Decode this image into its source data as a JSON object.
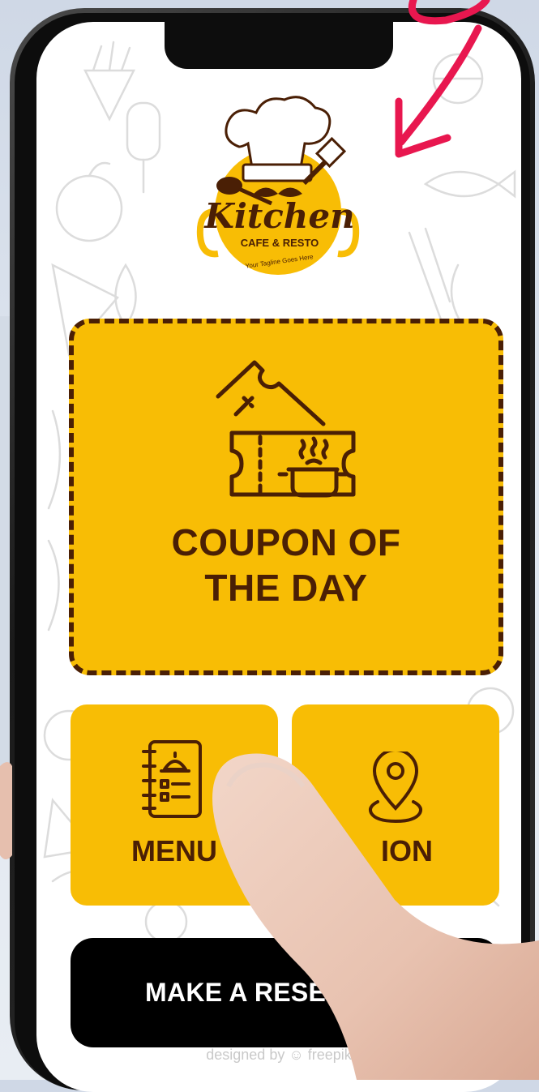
{
  "app": {
    "logo": {
      "name": "Kitchen",
      "subtitle": "CAFE & RESTO",
      "tagline": "Your Tagline Goes Here"
    },
    "coupon": {
      "title": "COUPON OF\nTHE DAY"
    },
    "tiles": {
      "menu_label": "MENU",
      "location_label": "ION"
    },
    "reservation": {
      "label": "MAKE A RESERVAT"
    },
    "credit": "designed by ☺ freepik"
  },
  "colors": {
    "accent": "#f8bd05",
    "dark_brown": "#4a1f05",
    "button_black": "#000000",
    "arrow_pink": "#e8174f"
  }
}
